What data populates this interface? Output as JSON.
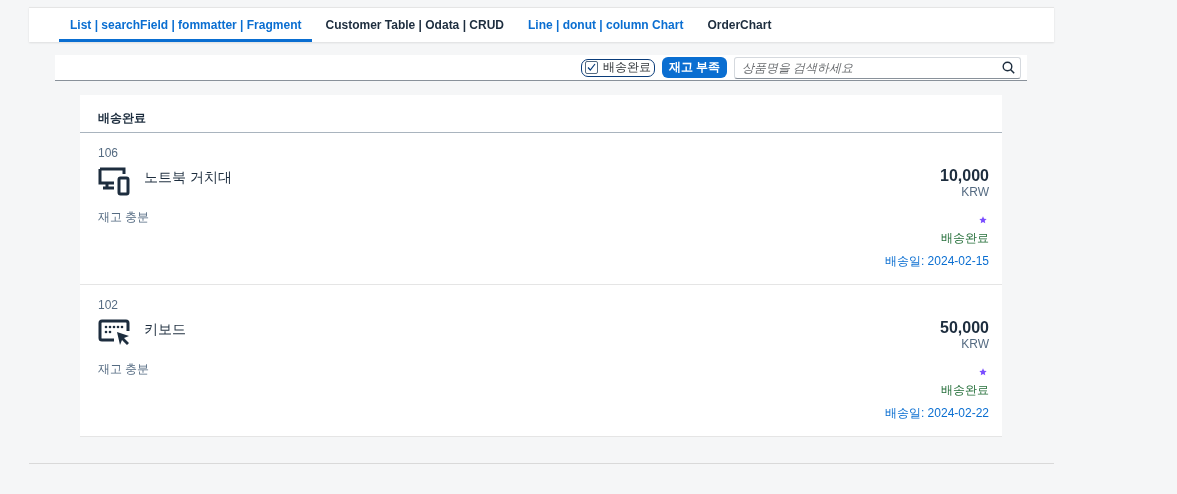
{
  "tabs": [
    {
      "label": "List | searchField | fommatter | Fragment",
      "selected": true,
      "color": "#0a6ed1"
    },
    {
      "label": "Customer Table | Odata | CRUD",
      "selected": false,
      "color": "#1d2d3e"
    },
    {
      "label": "Line | donut | column Chart",
      "selected": false,
      "color": "#0a6ed1"
    },
    {
      "label": "OrderChart",
      "selected": false,
      "color": "#1d2d3e"
    }
  ],
  "toolbar": {
    "filter_checkbox": {
      "label": "배송완료",
      "checked": true
    },
    "button": "재고 부족",
    "search": {
      "placeholder": "상품명을 검색하세요"
    }
  },
  "list": {
    "header": "배송완료",
    "items": [
      {
        "id": "106",
        "name": "노트북 거치대",
        "kind": "devices",
        "stock": "재고 충분",
        "price": "10,000",
        "currency": "KRW",
        "favorite": true,
        "status": "배송완료",
        "delivery": "배송일: 2024-02-15"
      },
      {
        "id": "102",
        "name": "키보드",
        "kind": "keyboard",
        "stock": "재고 충분",
        "price": "50,000",
        "currency": "KRW",
        "favorite": true,
        "status": "배송완료",
        "delivery": "배송일: 2024-02-22"
      }
    ]
  }
}
